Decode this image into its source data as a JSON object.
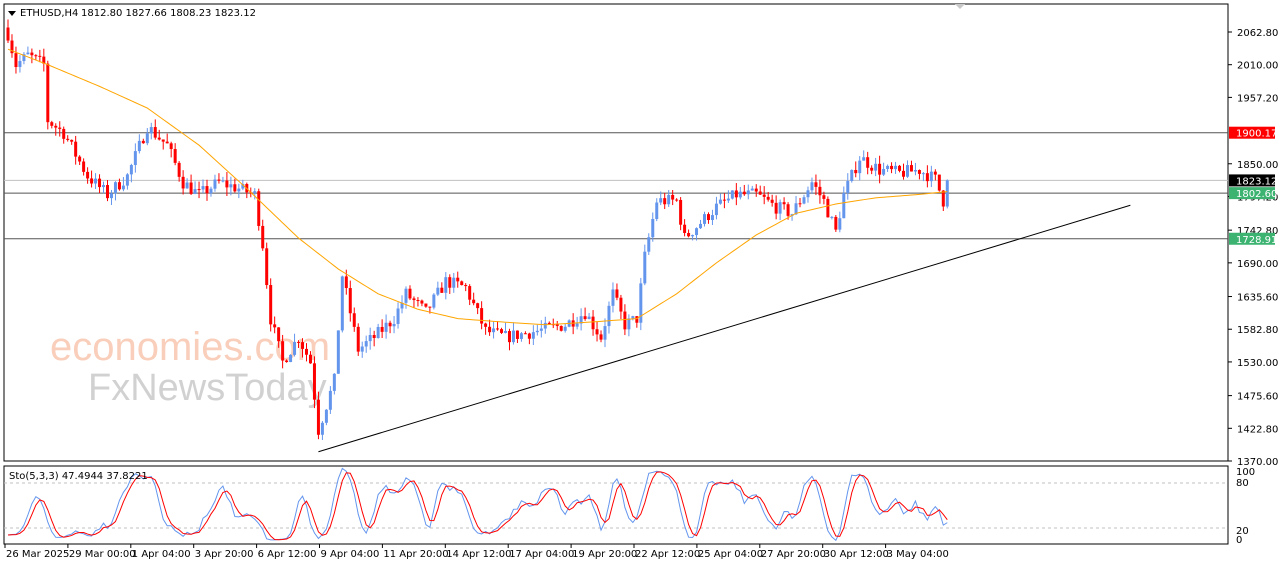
{
  "header": {
    "symbol": "ETHUSD,H4",
    "ohlc": "1812.80 1827.66 1808.23 1823.12"
  },
  "chart_data": {
    "type": "candlestick",
    "title": "ETHUSD,H4",
    "ylim": [
      1370.0,
      2062.8
    ],
    "y_ticks": [
      "2062.80",
      "2010.00",
      "1957.20",
      "1850.00",
      "1797.20",
      "1742.80",
      "1690.00",
      "1635.60",
      "1582.80",
      "1530.00",
      "1475.60",
      "1422.80",
      "1370.00"
    ],
    "x_ticks": [
      "26 Mar 2025",
      "29 Mar 00:00",
      "1 Apr 04:00",
      "3 Apr 20:00",
      "6 Apr 12:00",
      "9 Apr 04:00",
      "11 Apr 20:00",
      "14 Apr 12:00",
      "17 Apr 04:00",
      "19 Apr 20:00",
      "22 Apr 12:00",
      "25 Apr 04:00",
      "27 Apr 20:00",
      "30 Apr 12:00",
      "3 May 04:00"
    ],
    "bar_count": 237,
    "close_keypoints": [
      [
        0,
        2060
      ],
      [
        2,
        2010
      ],
      [
        5,
        2025
      ],
      [
        9,
        2010
      ],
      [
        10,
        1920
      ],
      [
        14,
        1900
      ],
      [
        20,
        1830
      ],
      [
        25,
        1800
      ],
      [
        30,
        1830
      ],
      [
        35,
        1910
      ],
      [
        40,
        1880
      ],
      [
        44,
        1820
      ],
      [
        48,
        1800
      ],
      [
        53,
        1820
      ],
      [
        58,
        1810
      ],
      [
        62,
        1800
      ],
      [
        64,
        1720
      ],
      [
        66,
        1600
      ],
      [
        69,
        1530
      ],
      [
        73,
        1570
      ],
      [
        76,
        1530
      ],
      [
        78,
        1420
      ],
      [
        82,
        1500
      ],
      [
        84,
        1670
      ],
      [
        88,
        1550
      ],
      [
        92,
        1570
      ],
      [
        97,
        1600
      ],
      [
        100,
        1640
      ],
      [
        105,
        1610
      ],
      [
        110,
        1660
      ],
      [
        115,
        1650
      ],
      [
        120,
        1580
      ],
      [
        125,
        1570
      ],
      [
        133,
        1580
      ],
      [
        140,
        1590
      ],
      [
        145,
        1610
      ],
      [
        149,
        1570
      ],
      [
        152,
        1640
      ],
      [
        155,
        1590
      ],
      [
        158,
        1600
      ],
      [
        160,
        1700
      ],
      [
        163,
        1790
      ],
      [
        168,
        1790
      ],
      [
        170,
        1730
      ],
      [
        178,
        1780
      ],
      [
        183,
        1800
      ],
      [
        188,
        1800
      ],
      [
        193,
        1780
      ],
      [
        197,
        1770
      ],
      [
        202,
        1820
      ],
      [
        205,
        1790
      ],
      [
        208,
        1740
      ],
      [
        210,
        1800
      ],
      [
        214,
        1860
      ],
      [
        219,
        1840
      ],
      [
        224,
        1835
      ],
      [
        229,
        1840
      ],
      [
        233,
        1825
      ],
      [
        235,
        1790
      ],
      [
        236,
        1823.12
      ]
    ],
    "ma_keypoints": [
      [
        0,
        2035
      ],
      [
        10,
        2010
      ],
      [
        23,
        1975
      ],
      [
        35,
        1940
      ],
      [
        48,
        1880
      ],
      [
        60,
        1810
      ],
      [
        73,
        1730
      ],
      [
        83,
        1680
      ],
      [
        93,
        1640
      ],
      [
        103,
        1615
      ],
      [
        113,
        1600
      ],
      [
        123,
        1595
      ],
      [
        135,
        1590
      ],
      [
        148,
        1595
      ],
      [
        158,
        1600
      ],
      [
        168,
        1640
      ],
      [
        178,
        1690
      ],
      [
        188,
        1735
      ],
      [
        198,
        1770
      ],
      [
        208,
        1785
      ],
      [
        218,
        1795
      ],
      [
        228,
        1800
      ],
      [
        236,
        1805
      ]
    ],
    "horizontal_levels": [
      {
        "price": 1900.17,
        "label": "1900.17",
        "color": "#ff0000"
      },
      {
        "price": 1823.12,
        "label": "1823.12",
        "color": "#000000",
        "line": "#c0c0c0"
      },
      {
        "price": 1802.6,
        "label": "1802.60",
        "color": "#3cb371"
      },
      {
        "price": 1728.91,
        "label": "1728.91",
        "color": "#3cb371"
      }
    ],
    "trendline": [
      [
        78,
        1385
      ],
      [
        282,
        1783
      ]
    ],
    "stochastic": {
      "label": "Sto(5,3,3) 47.4944 37.8221",
      "levels": [
        "100",
        "80",
        "20",
        "0"
      ]
    },
    "colors": {
      "bull": "#6495ed",
      "bear": "#ff0000",
      "ma": "#ffa500",
      "stoch_main": "#6495ed",
      "stoch_signal": "#ff0000"
    }
  },
  "watermark": {
    "line1": "economies.com",
    "line2": "FxNewsToday"
  }
}
